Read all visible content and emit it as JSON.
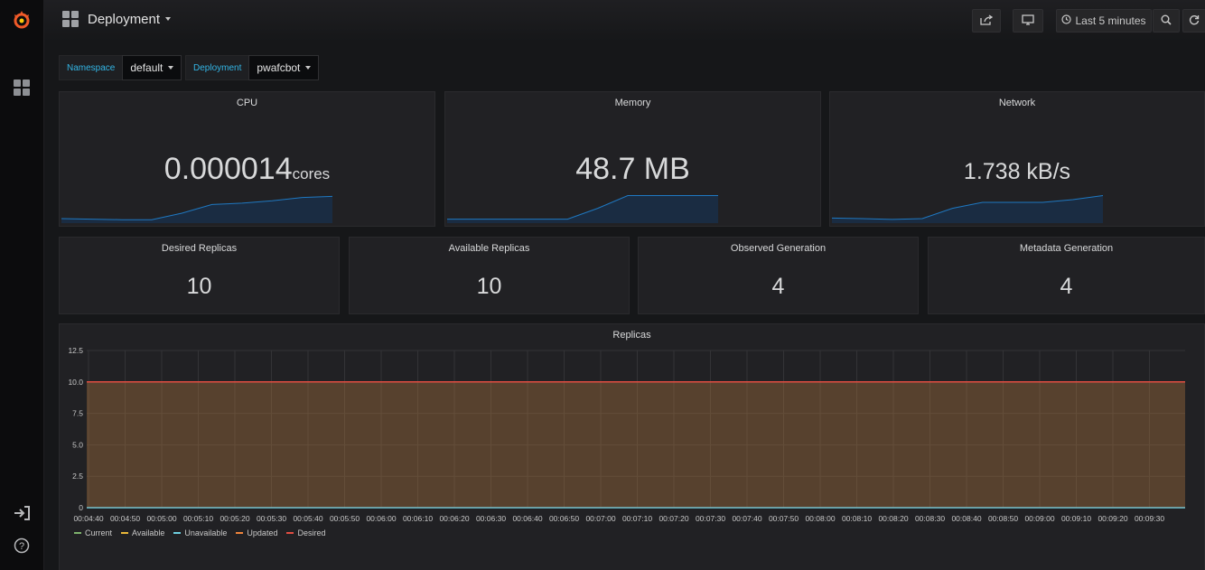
{
  "header": {
    "title": "Deployment",
    "time_range": "Last 5 minutes"
  },
  "variables": [
    {
      "label": "Namespace",
      "value": "default"
    },
    {
      "label": "Deployment",
      "value": "pwafcbot"
    }
  ],
  "stats_top": [
    {
      "title": "CPU",
      "value": "0.000014",
      "unit": "cores",
      "trend": [
        0.1,
        0.08,
        0.06,
        0.06,
        0.3,
        0.62,
        0.67,
        0.76,
        0.88,
        0.92
      ]
    },
    {
      "title": "Memory",
      "value": "48.7 MB",
      "unit": "",
      "trend": [
        0.08,
        0.08,
        0.08,
        0.08,
        0.08,
        0.48,
        0.95,
        0.95,
        0.95,
        0.95
      ]
    },
    {
      "title": "Network",
      "value": "1.738 kB/s",
      "unit": "",
      "trend": [
        0.12,
        0.1,
        0.07,
        0.1,
        0.48,
        0.7,
        0.7,
        0.7,
        0.8,
        0.95
      ]
    }
  ],
  "stats_bottom": [
    {
      "title": "Desired Replicas",
      "value": "10"
    },
    {
      "title": "Available Replicas",
      "value": "10"
    },
    {
      "title": "Observed Generation",
      "value": "4"
    },
    {
      "title": "Metadata Generation",
      "value": "4"
    }
  ],
  "chart_data": {
    "type": "area",
    "title": "Replicas",
    "ylim": [
      0,
      12.5
    ],
    "yticks": [
      "12.5",
      "10.0",
      "7.5",
      "5.0",
      "2.5",
      "0"
    ],
    "ytick_values": [
      12.5,
      10,
      7.5,
      5,
      2.5,
      0
    ],
    "x": [
      "00:04:40",
      "00:04:50",
      "00:05:00",
      "00:05:10",
      "00:05:20",
      "00:05:30",
      "00:05:40",
      "00:05:50",
      "00:06:00",
      "00:06:10",
      "00:06:20",
      "00:06:30",
      "00:06:40",
      "00:06:50",
      "00:07:00",
      "00:07:10",
      "00:07:20",
      "00:07:30",
      "00:07:40",
      "00:07:50",
      "00:08:00",
      "00:08:10",
      "00:08:20",
      "00:08:30",
      "00:08:40",
      "00:08:50",
      "00:09:00",
      "00:09:10",
      "00:09:20",
      "00:09:30"
    ],
    "grid": true,
    "legend_position": "bottom-left",
    "series": [
      {
        "name": "Current",
        "color": "#7eb26d",
        "value": 10
      },
      {
        "name": "Available",
        "color": "#eab839",
        "value": 10
      },
      {
        "name": "Unavailable",
        "color": "#6ed0e0",
        "value": 0
      },
      {
        "name": "Updated",
        "color": "#ef843c",
        "value": 10
      },
      {
        "name": "Desired",
        "color": "#e24d42",
        "value": 10
      }
    ]
  },
  "colors": {
    "accent": "#33b5e5",
    "spark_line": "#1f78c1",
    "spark_fill": "#1a2c42",
    "area_fill": "#5a4030"
  }
}
